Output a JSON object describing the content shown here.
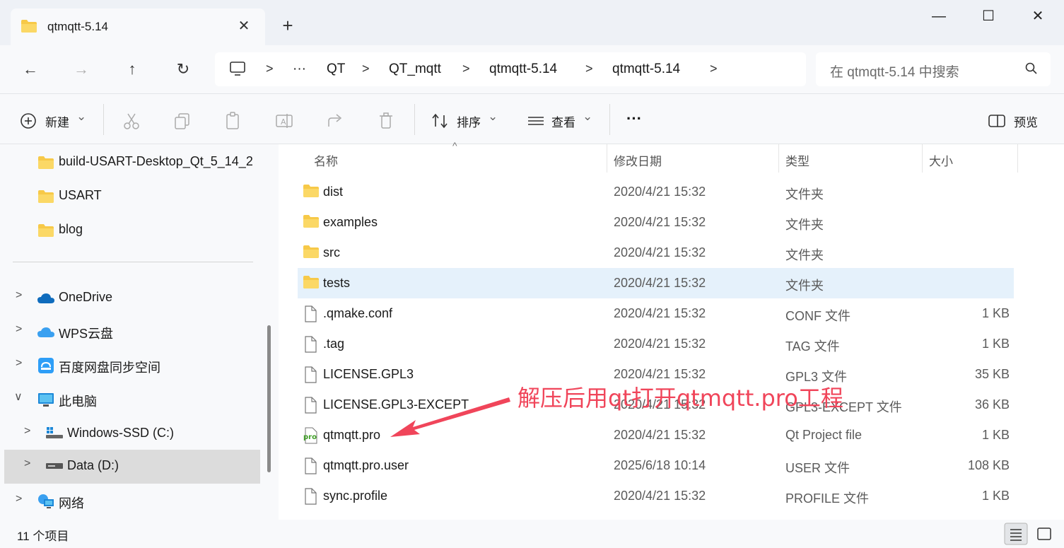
{
  "window": {
    "tab_title": "qtmqtt-5.14",
    "tab_close": "✕",
    "new_tab": "+",
    "minimize": "—",
    "maximize": "☐",
    "close": "✕"
  },
  "nav": {
    "back": "←",
    "forward": "→",
    "up": "↑",
    "refresh": "↻",
    "ellipsis": "···",
    "breadcrumbs": [
      "QT",
      "QT_mqtt",
      "qtmqtt-5.14",
      "qtmqtt-5.14"
    ],
    "separator": ">",
    "search_placeholder": "在 qtmqtt-5.14 中搜索"
  },
  "toolbar": {
    "new_label": "新建",
    "sort_label": "排序",
    "view_label": "查看",
    "more": "···",
    "preview_label": "预览",
    "dropdown": "⌄"
  },
  "sidebar": {
    "chevron_right": ">",
    "chevron_down": "∨",
    "pinned": [
      "build-USART-Desktop_Qt_5_14_2",
      "USART",
      "blog"
    ],
    "tree": [
      {
        "label": "OneDrive"
      },
      {
        "label": "WPS云盘"
      },
      {
        "label": "百度网盘同步空间"
      },
      {
        "label": "此电脑"
      },
      {
        "label": "Windows-SSD (C:)"
      },
      {
        "label": "Data (D:)"
      },
      {
        "label": "网络"
      }
    ]
  },
  "columns": {
    "name": "名称",
    "date": "修改日期",
    "type": "类型",
    "size": "大小",
    "sort_arrow": "^"
  },
  "files": [
    {
      "name": "dist",
      "date": "2020/4/21 15:32",
      "type": "文件夹",
      "size": ""
    },
    {
      "name": "examples",
      "date": "2020/4/21 15:32",
      "type": "文件夹",
      "size": ""
    },
    {
      "name": "src",
      "date": "2020/4/21 15:32",
      "type": "文件夹",
      "size": ""
    },
    {
      "name": "tests",
      "date": "2020/4/21 15:32",
      "type": "文件夹",
      "size": ""
    },
    {
      "name": ".qmake.conf",
      "date": "2020/4/21 15:32",
      "type": "CONF 文件",
      "size": "1 KB"
    },
    {
      "name": ".tag",
      "date": "2020/4/21 15:32",
      "type": "TAG 文件",
      "size": "1 KB"
    },
    {
      "name": "LICENSE.GPL3",
      "date": "2020/4/21 15:32",
      "type": "GPL3 文件",
      "size": "35 KB"
    },
    {
      "name": "LICENSE.GPL3-EXCEPT",
      "date": "2020/4/21 15:32",
      "type": "GPL3-EXCEPT 文件",
      "size": "36 KB"
    },
    {
      "name": "qtmqtt.pro",
      "date": "2020/4/21 15:32",
      "type": "Qt Project file",
      "size": "1 KB"
    },
    {
      "name": "qtmqtt.pro.user",
      "date": "2025/6/18 10:14",
      "type": "USER 文件",
      "size": "108 KB"
    },
    {
      "name": "sync.profile",
      "date": "2020/4/21 15:32",
      "type": "PROFILE 文件",
      "size": "1 KB"
    }
  ],
  "pro_icon_text": "pro",
  "annotation": "解压后用qt打开qtmqtt.pro工程",
  "status": {
    "count": "11 个项目"
  },
  "colors": {
    "accent": "#0067c0",
    "folder": "#f7c948",
    "selected": "#e5f1fb",
    "annotation": "#f0455a"
  }
}
